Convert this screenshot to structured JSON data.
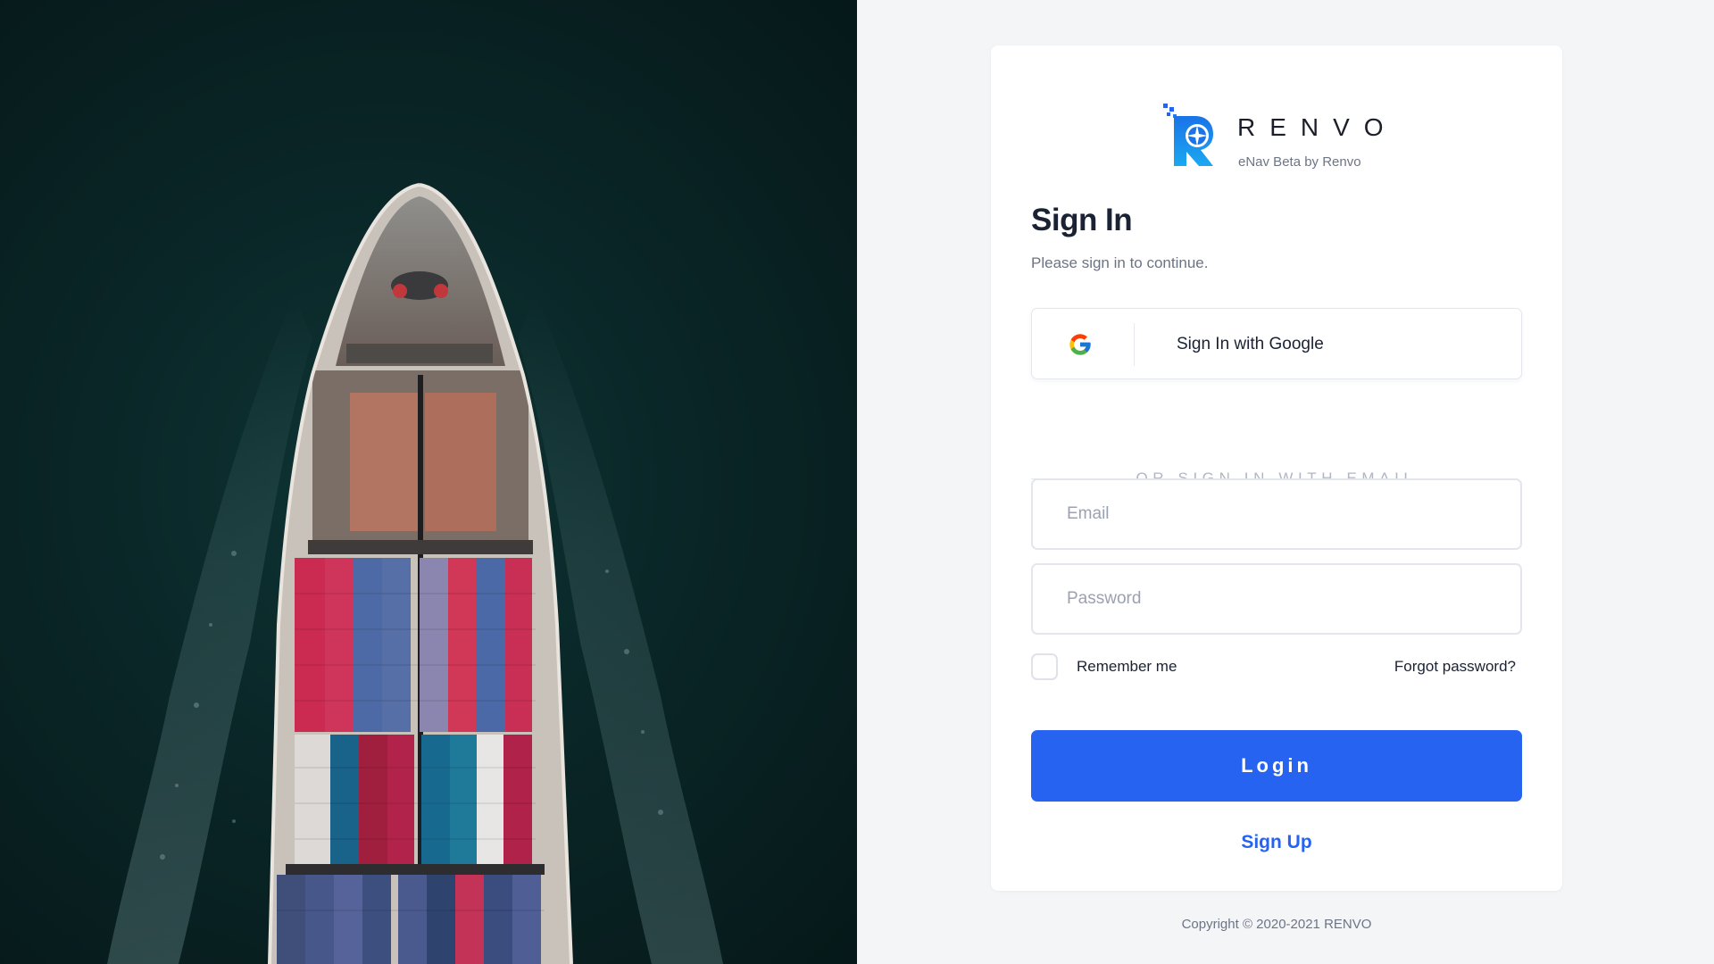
{
  "hero": {
    "alt": "Aerial view of container ship at sea"
  },
  "brand": {
    "name": "RENVO",
    "tagline": "eNav Beta by Renvo"
  },
  "auth": {
    "title": "Sign In",
    "subtitle": "Please sign in to continue.",
    "google_label": "Sign In with Google",
    "divider": "OR SIGN IN WITH EMAIL",
    "email_placeholder": "Email",
    "password_placeholder": "Password",
    "remember_label": "Remember me",
    "forgot_label": "Forgot password?",
    "login_label": "Login",
    "signup_label": "Sign Up"
  },
  "footer": {
    "copyright": "Copyright © 2020-2021 RENVO"
  },
  "colors": {
    "accent": "#2563f0",
    "background": "#f4f5f7",
    "card": "#ffffff",
    "text": "#1a2233"
  }
}
